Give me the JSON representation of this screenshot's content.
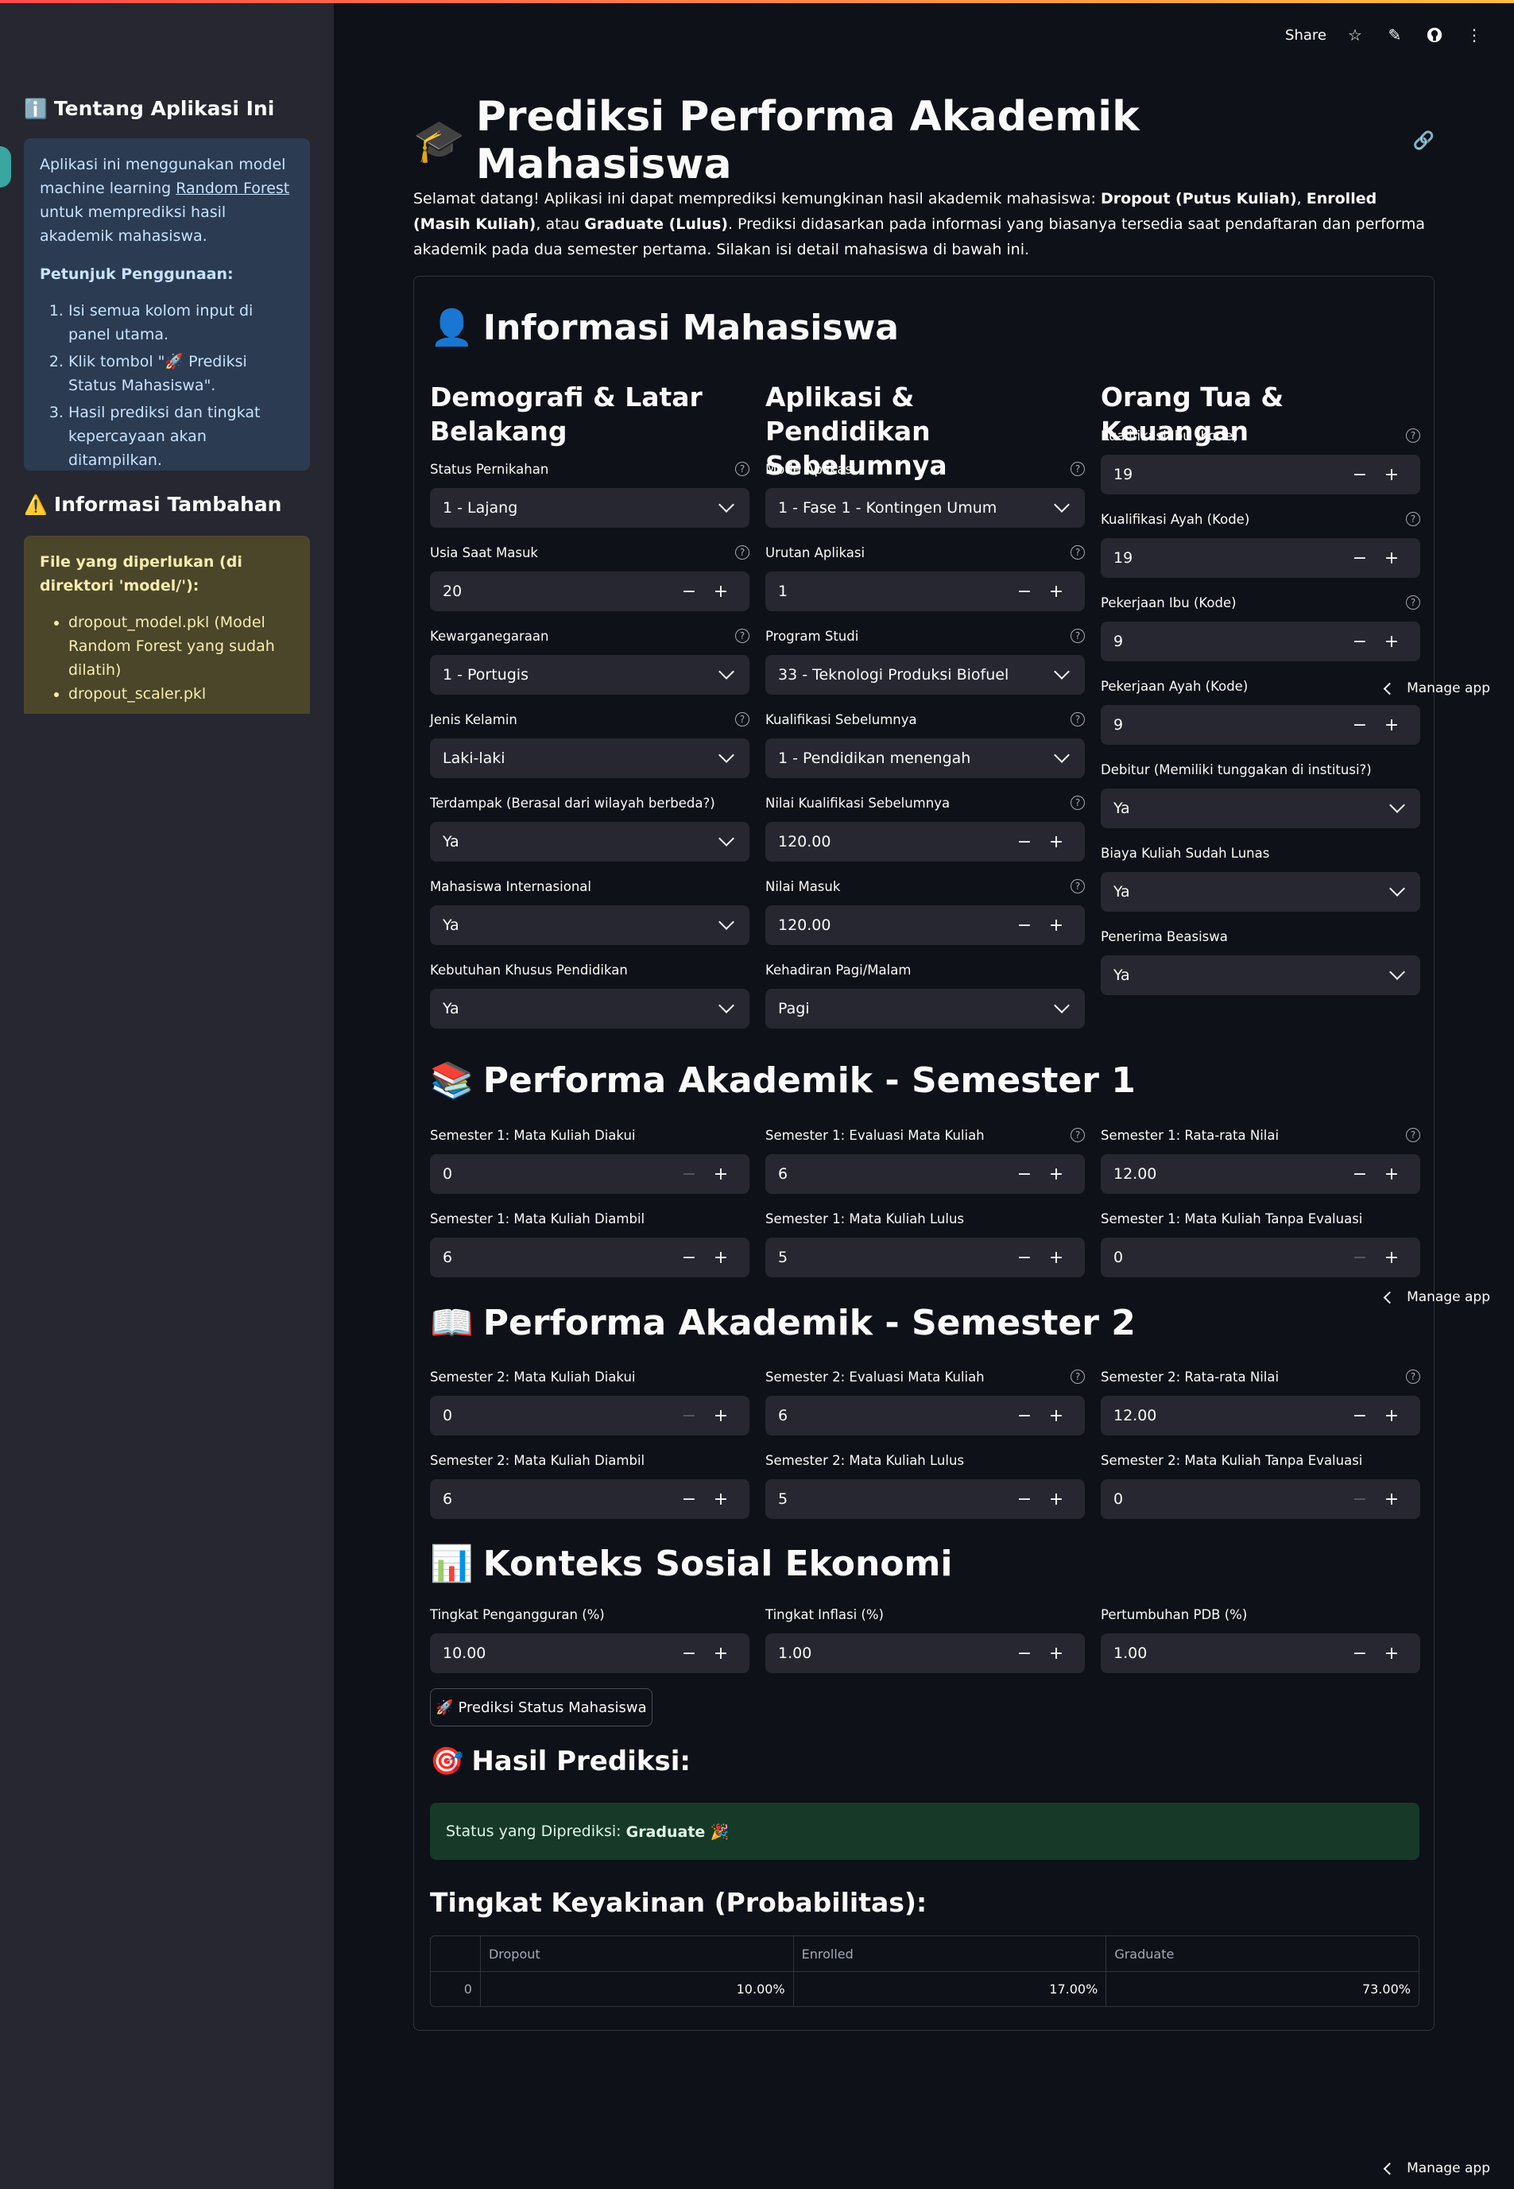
{
  "toolbar": {
    "share_label": "Share",
    "icons": [
      "star-icon",
      "edit-icon",
      "github-icon",
      "more-icon"
    ]
  },
  "sidebar": {
    "about_title": "Tentang Aplikasi Ini",
    "about_text_1": "Aplikasi ini menggunakan model machine learning ",
    "about_link": "Random Forest",
    "about_text_2": " untuk memprediksi hasil akademik mahasiswa.",
    "guide_title": "Petunjuk Penggunaan:",
    "guide_steps": [
      "Isi semua kolom input di panel utama.",
      "Klik tombol \"🚀 Prediksi Status Mahasiswa\".",
      "Hasil prediksi dan tingkat kepercayaan akan ditampilkan."
    ],
    "extra_title": "Informasi Tambahan",
    "files_title": "File yang diperlukan (di direktori 'model/'):",
    "files": [
      "dropout_model.pkl (Model Random Forest yang sudah dilatih)",
      "dropout_scaler.pkl"
    ]
  },
  "main": {
    "title": "Prediksi Performa Akademik Mahasiswa",
    "intro_1": "Selamat datang! Aplikasi ini dapat memprediksi kemungkinan hasil akademik mahasiswa: ",
    "intro_dropout": "Dropout (Putus Kuliah)",
    "intro_sep1": ", ",
    "intro_enrolled": "Enrolled (Masih Kuliah)",
    "intro_sep2": ", atau ",
    "intro_graduate": "Graduate (Lulus)",
    "intro_2": ". Prediksi didasarkan pada informasi yang biasanya tersedia saat pendaftaran dan performa akademik pada dua semester pertama. Silakan isi detail mahasiswa di bawah ini."
  },
  "sections": {
    "info": "Informasi Mahasiswa",
    "sem1": "Performa Akademik - Semester 1",
    "sem2": "Performa Akademik - Semester 2",
    "socio": "Konteks Sosial Ekonomi"
  },
  "columns": {
    "demo": "Demografi & Latar Belakang",
    "app": "Aplikasi & Pendidikan Sebelumnya",
    "parents": "Orang Tua & Keuangan"
  },
  "demo": [
    {
      "label": "Status Pernikahan",
      "value": "1 - Lajang",
      "type": "select",
      "help": true
    },
    {
      "label": "Usia Saat Masuk",
      "value": "20",
      "type": "number",
      "help": true
    },
    {
      "label": "Kewarganegaraan",
      "value": "1 - Portugis",
      "type": "select",
      "help": true
    },
    {
      "label": "Jenis Kelamin",
      "value": "Laki-laki",
      "type": "select",
      "help": true
    },
    {
      "label": "Terdampak (Berasal dari wilayah berbeda?)",
      "value": "Ya",
      "type": "select",
      "help": false
    },
    {
      "label": "Mahasiswa Internasional",
      "value": "Ya",
      "type": "select",
      "help": false
    },
    {
      "label": "Kebutuhan Khusus Pendidikan",
      "value": "Ya",
      "type": "select",
      "help": false
    }
  ],
  "app": [
    {
      "label": "Mode Aplikasi",
      "value": "1 - Fase 1 - Kontingen Umum",
      "type": "select",
      "help": true
    },
    {
      "label": "Urutan Aplikasi",
      "value": "1",
      "type": "number",
      "help": true
    },
    {
      "label": "Program Studi",
      "value": "33 - Teknologi Produksi Biofuel",
      "type": "select",
      "help": true
    },
    {
      "label": "Kualifikasi Sebelumnya",
      "value": "1 - Pendidikan menengah",
      "type": "select",
      "help": true
    },
    {
      "label": "Nilai Kualifikasi Sebelumnya",
      "value": "120.00",
      "type": "number",
      "help": true
    },
    {
      "label": "Nilai Masuk",
      "value": "120.00",
      "type": "number",
      "help": true
    },
    {
      "label": "Kehadiran Pagi/Malam",
      "value": "Pagi",
      "type": "select",
      "help": false
    }
  ],
  "parents": [
    {
      "label": "Kualifikasi Ibu (Kode)",
      "value": "19",
      "type": "number",
      "help": true
    },
    {
      "label": "Kualifikasi Ayah (Kode)",
      "value": "19",
      "type": "number",
      "help": true
    },
    {
      "label": "Pekerjaan Ibu (Kode)",
      "value": "9",
      "type": "number",
      "help": true
    },
    {
      "label": "Pekerjaan Ayah (Kode)",
      "value": "9",
      "type": "number",
      "help": false
    },
    {
      "label": "Debitur (Memiliki tunggakan di institusi?)",
      "value": "Ya",
      "type": "select",
      "help": false
    },
    {
      "label": "Biaya Kuliah Sudah Lunas",
      "value": "Ya",
      "type": "select",
      "help": false
    },
    {
      "label": "Penerima Beasiswa",
      "value": "Ya",
      "type": "select",
      "help": false
    }
  ],
  "sem1": [
    {
      "label": "Semester 1: Mata Kuliah Diakui",
      "value": "0",
      "help": false,
      "minus_disabled": true
    },
    {
      "label": "Semester 1: Evaluasi Mata Kuliah",
      "value": "6",
      "help": true,
      "minus_disabled": false
    },
    {
      "label": "Semester 1: Rata-rata Nilai",
      "value": "12.00",
      "help": true,
      "minus_disabled": false
    },
    {
      "label": "Semester 1: Mata Kuliah Diambil",
      "value": "6",
      "help": false,
      "minus_disabled": false
    },
    {
      "label": "Semester 1: Mata Kuliah Lulus",
      "value": "5",
      "help": false,
      "minus_disabled": false
    },
    {
      "label": "Semester 1: Mata Kuliah Tanpa Evaluasi",
      "value": "0",
      "help": false,
      "minus_disabled": true
    }
  ],
  "sem2": [
    {
      "label": "Semester 2: Mata Kuliah Diakui",
      "value": "0",
      "help": false,
      "minus_disabled": true
    },
    {
      "label": "Semester 2: Evaluasi Mata Kuliah",
      "value": "6",
      "help": true,
      "minus_disabled": false
    },
    {
      "label": "Semester 2: Rata-rata Nilai",
      "value": "12.00",
      "help": true,
      "minus_disabled": false
    },
    {
      "label": "Semester 2: Mata Kuliah Diambil",
      "value": "6",
      "help": false,
      "minus_disabled": false
    },
    {
      "label": "Semester 2: Mata Kuliah Lulus",
      "value": "5",
      "help": false,
      "minus_disabled": false
    },
    {
      "label": "Semester 2: Mata Kuliah Tanpa Evaluasi",
      "value": "0",
      "help": false,
      "minus_disabled": true
    }
  ],
  "socio": [
    {
      "label": "Tingkat Pengangguran (%)",
      "value": "10.00",
      "help": false,
      "minus_disabled": false
    },
    {
      "label": "Tingkat Inflasi (%)",
      "value": "1.00",
      "help": false,
      "minus_disabled": false
    },
    {
      "label": "Pertumbuhan PDB (%)",
      "value": "1.00",
      "help": false,
      "minus_disabled": false
    }
  ],
  "predict_button": "🚀 Prediksi Status Mahasiswa",
  "result": {
    "title": "Hasil Prediksi:",
    "status_prefix": "Status yang Diprediksi:",
    "status_value": "Graduate 🎉",
    "prob_title": "Tingkat Keyakinan (Probabilitas):",
    "table": {
      "columns": [
        "Dropout",
        "Enrolled",
        "Graduate"
      ],
      "rows": [
        {
          "index": "0",
          "values": [
            "10.00%",
            "17.00%",
            "73.00%"
          ]
        }
      ]
    }
  },
  "manage_app_label": "Manage app",
  "colors": {
    "accent_gradient_start": "#ff4b4b",
    "accent_gradient_end": "#ffbd45",
    "success_bg": "#173928",
    "info_bg": "#2b3b52",
    "warning_bg": "#4b4629"
  }
}
